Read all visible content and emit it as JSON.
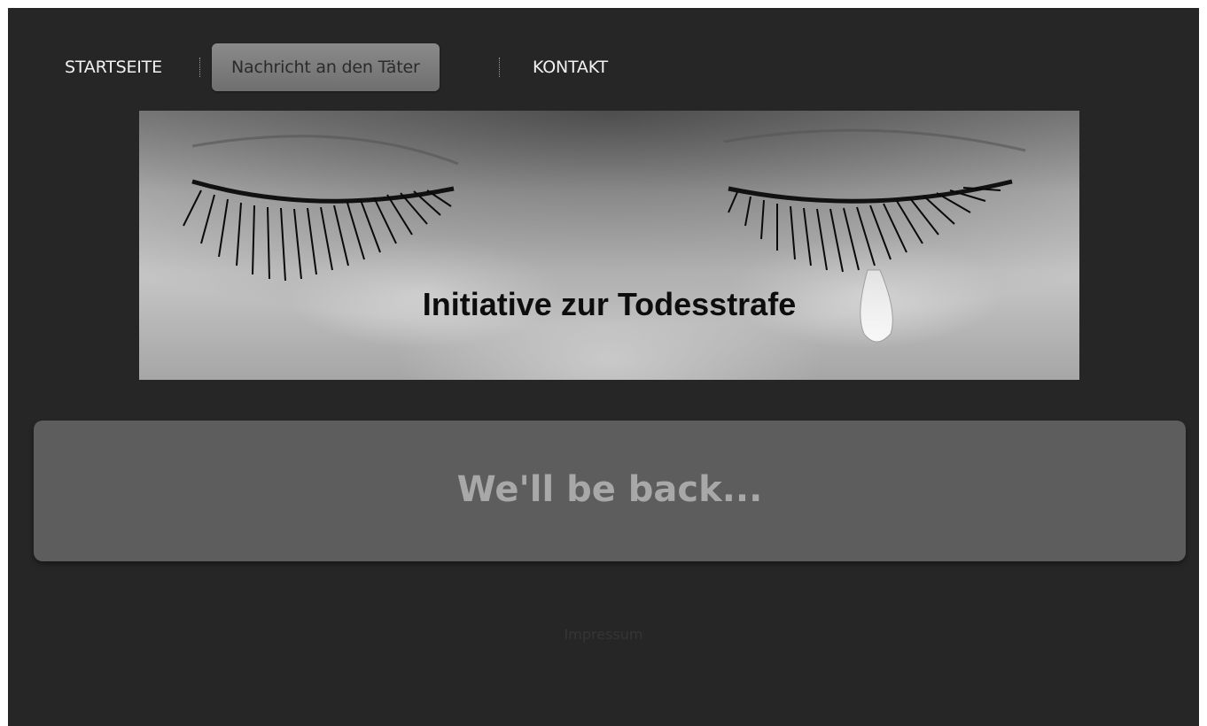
{
  "nav": {
    "items": [
      {
        "label": "STARTSEITE",
        "active": false
      },
      {
        "label": "Nachricht an den Täter",
        "active": true
      },
      {
        "label": "KONTAKT",
        "active": false
      }
    ]
  },
  "banner": {
    "title": "Initiative zur Todesstrafe",
    "image_description_icon": "crying-eyes-photo"
  },
  "content": {
    "message": "We'll be back..."
  },
  "footer": {
    "link_label": "Impressum"
  },
  "colors": {
    "page_background": "#262626",
    "nav_active_background": "#7a7a7a",
    "content_box_background": "#5d5d5d",
    "content_text": "#a8a8a8"
  }
}
